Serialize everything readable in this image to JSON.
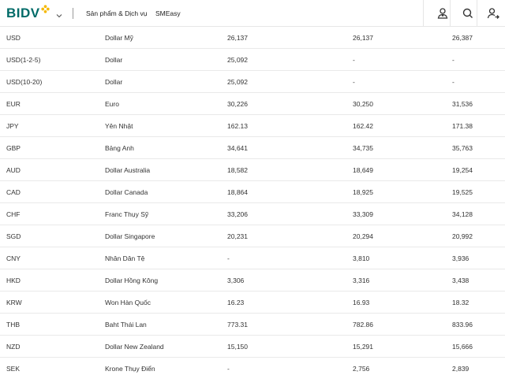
{
  "brand": {
    "logo_text": "BIDV",
    "accent": "#006b68",
    "star_color": "#f5b800"
  },
  "header": {
    "nav": [
      {
        "label": "Sản phẩm & Dịch vụ"
      },
      {
        "label": "SMEasy"
      }
    ],
    "icons": [
      "user-icon",
      "search-icon",
      "login-icon"
    ]
  },
  "rates": {
    "rows": [
      {
        "code": "USD",
        "name": "Dollar Mỹ",
        "cash": "26,137",
        "transfer": "26,137",
        "sell": "26,387"
      },
      {
        "code": "USD(1-2-5)",
        "name": "Dollar",
        "cash": "25,092",
        "transfer": "-",
        "sell": "-"
      },
      {
        "code": "USD(10-20)",
        "name": "Dollar",
        "cash": "25,092",
        "transfer": "-",
        "sell": "-"
      },
      {
        "code": "EUR",
        "name": "Euro",
        "cash": "30,226",
        "transfer": "30,250",
        "sell": "31,536"
      },
      {
        "code": "JPY",
        "name": "Yên Nhật",
        "cash": "162.13",
        "transfer": "162.42",
        "sell": "171.38"
      },
      {
        "code": "GBP",
        "name": "Bảng Anh",
        "cash": "34,641",
        "transfer": "34,735",
        "sell": "35,763"
      },
      {
        "code": "AUD",
        "name": "Dollar Australia",
        "cash": "18,582",
        "transfer": "18,649",
        "sell": "19,254"
      },
      {
        "code": "CAD",
        "name": "Dollar Canada",
        "cash": "18,864",
        "transfer": "18,925",
        "sell": "19,525"
      },
      {
        "code": "CHF",
        "name": "Franc Thụy Sỹ",
        "cash": "33,206",
        "transfer": "33,309",
        "sell": "34,128"
      },
      {
        "code": "SGD",
        "name": "Dollar Singapore",
        "cash": "20,231",
        "transfer": "20,294",
        "sell": "20,992"
      },
      {
        "code": "CNY",
        "name": "Nhân Dân Tệ",
        "cash": "-",
        "transfer": "3,810",
        "sell": "3,936"
      },
      {
        "code": "HKD",
        "name": "Dollar Hồng Kông",
        "cash": "3,306",
        "transfer": "3,316",
        "sell": "3,438"
      },
      {
        "code": "KRW",
        "name": "Won Hàn Quốc",
        "cash": "16.23",
        "transfer": "16.93",
        "sell": "18.32"
      },
      {
        "code": "THB",
        "name": "Baht Thái Lan",
        "cash": "773.31",
        "transfer": "782.86",
        "sell": "833.96"
      },
      {
        "code": "NZD",
        "name": "Dollar New Zealand",
        "cash": "15,150",
        "transfer": "15,291",
        "sell": "15,666"
      },
      {
        "code": "SEK",
        "name": "Krone Thụy Điển",
        "cash": "-",
        "transfer": "2,756",
        "sell": "2,839"
      }
    ]
  }
}
